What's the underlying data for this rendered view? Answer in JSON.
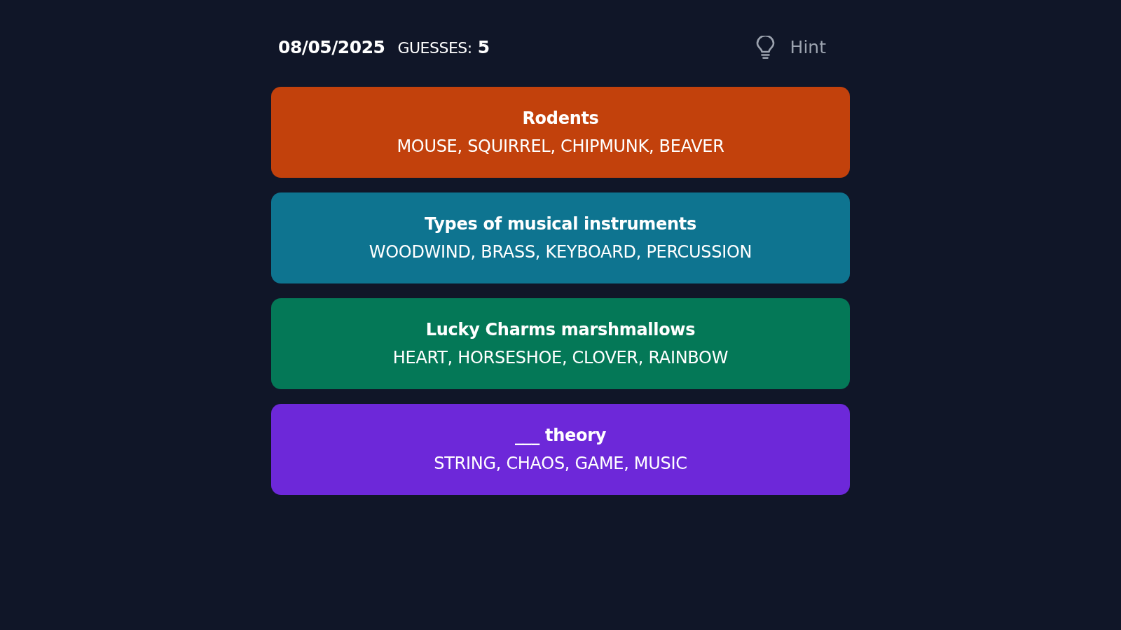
{
  "header": {
    "date": "08/05/2025",
    "guesses_label": "GUESSES:",
    "guesses_count": "5",
    "hint_label": "Hint"
  },
  "groups": [
    {
      "title": "Rodents",
      "words": "MOUSE, SQUIRREL, CHIPMUNK, BEAVER",
      "color": "#c2410c"
    },
    {
      "title": "Types of musical instruments",
      "words": "WOODWIND, BRASS, KEYBOARD, PERCUSSION",
      "color": "#0e7490"
    },
    {
      "title": "Lucky Charms marshmallows",
      "words": "HEART, HORSESHOE, CLOVER, RAINBOW",
      "color": "#047857"
    },
    {
      "title": "___ theory",
      "words": "STRING, CHAOS, GAME, MUSIC",
      "color": "#6d28d9"
    }
  ]
}
